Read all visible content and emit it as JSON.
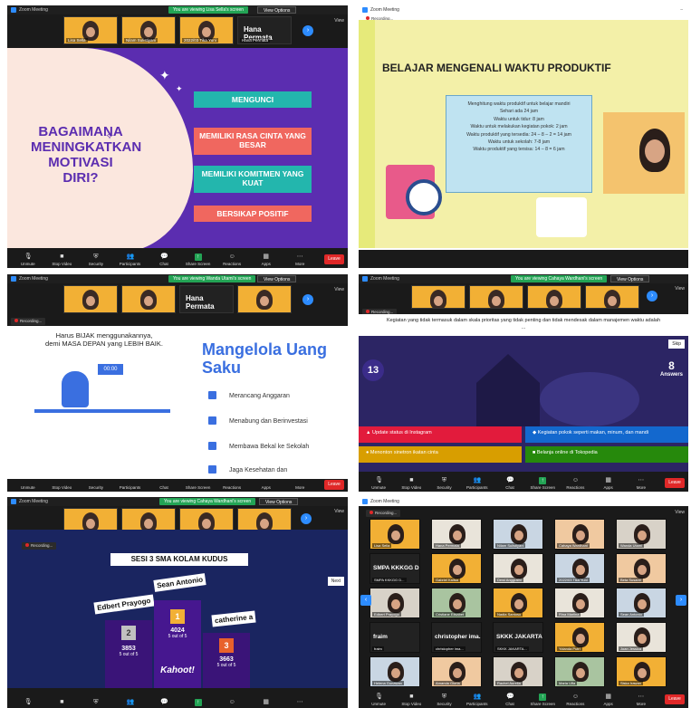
{
  "common": {
    "window_title": "Zoom Meeting",
    "view_label": "View",
    "view_options": "View Options",
    "recording": "Recording...",
    "leave": "Leave",
    "toolbar": [
      "Unmute",
      "Stop Video",
      "Security",
      "Participants",
      "Chat",
      "Share Screen",
      "Reactions",
      "Apps",
      "More"
    ]
  },
  "tile1": {
    "viewing": "You are viewing Lisa Sella's screen",
    "presenter": "Hana Permata",
    "thumbs": [
      "Lisa Sella",
      "Nilam Sulistiyani",
      "2022/03 Tika Yuni"
    ],
    "presenter_tag": "Hana Permata",
    "question": "BAGAIMANA MENINGKATKAN MOTIVASI DIRI?",
    "pills": [
      {
        "text": "MENGUNCI",
        "color": "#23b6ad"
      },
      {
        "text": "MEMILIKI RASA CINTA YANG BESAR",
        "color": "#f0675f"
      },
      {
        "text": "MEMILIKI KOMITMEN YANG KUAT",
        "color": "#23b6ad"
      },
      {
        "text": "BERSIKAP POSITIF",
        "color": "#f0675f"
      }
    ],
    "participant_count": "101"
  },
  "tile2": {
    "title": "BELAJAR MENGENALI WAKTU PRODUKTIF",
    "lines": [
      "Menghitung waktu produktif untuk belajar mandiri",
      "Sehari ada 24 jam",
      "Waktu untuk tidur: 8 jam",
      "Waktu untuk melakukan kegiatan pokok: 2 jam",
      "Waktu produktif yang tersedia: 24 – 8 – 2 = 14 jam",
      "Waktu untuk sekolah: 7-8 jam",
      "Waktu produktif yang tersisa: 14 – 8 = 6 jam"
    ]
  },
  "tile3": {
    "viewing": "You are viewing Wanda Utami's screen",
    "presenter": "Hana Permata",
    "tagline1": "Harus BIJAK menggunakannya,",
    "tagline2": "demi MASA DEPAN yang LEBIH BAIK.",
    "heading": "Mangelola Uang Saku",
    "items": [
      "Merancang Anggaran",
      "Menabung dan Berinvestasi",
      "Membawa Bekal ke Sekolah",
      "Jaga Kesehatan dan"
    ],
    "clock": "00:00"
  },
  "tile4": {
    "viewing": "You are viewing Cahaya Wardhani's screen",
    "question": "Kegiatan yang tidak termasuk dalam skala prioritas yang tidak penting dan tidak mendesak dalam manajemen waktu adalah ...",
    "timer": "13",
    "answers_count": "8",
    "answers_label": "Answers",
    "skip": "Skip",
    "answers": [
      {
        "text": "Update status di Instagram",
        "color": "#e21b3c"
      },
      {
        "text": "Kegiatan pokok seperti makan, minum, dan mandi",
        "color": "#1368ce"
      },
      {
        "text": "Menonton sinetron ikatan cinta",
        "color": "#d89e00"
      },
      {
        "text": "Belanja online di Tokopedia",
        "color": "#26890c"
      }
    ]
  },
  "tile5": {
    "viewing": "You are viewing Cahaya Wardhani's screen",
    "title": "SESI 3 SMA KOLAM KUDUS",
    "podium": [
      {
        "name": "Sean Antonio",
        "rank": "1",
        "score": "4024",
        "out": "5 out of 5"
      },
      {
        "name": "Edbert Prayogo",
        "rank": "2",
        "score": "3853",
        "out": "5 out of 5"
      },
      {
        "name": "catherine a",
        "rank": "3",
        "score": "3663",
        "out": "5 out of 5"
      }
    ],
    "brand": "Kahoot!",
    "next": "Next"
  },
  "tile6": {
    "rows": [
      [
        "Lisa Sella",
        "Hana Permata",
        "Nilam Sulistiyani",
        "Cahaya Wardhani",
        "Wanda Utami"
      ],
      [
        "SMPA KKKGG D...",
        "Gabriel Kallsa",
        "Dewi Anggraini",
        "2022/03 Tika Yuni",
        "Beta Susanti"
      ],
      [
        "Edbert Prayogo",
        "Cristiane Elisabet",
        "Nadia Santoso",
        "Rina Marlina",
        "Sean Antonio"
      ],
      [
        "fraim",
        "christopher ima...",
        "SKKK JAKARTA...",
        "Yolanda Putri",
        "Joan Jessica"
      ],
      [
        "Helena Gunawan",
        "Amanda Gloria",
        "Rachel Aurelia",
        "Maria Ulfa",
        "Siska Irawan"
      ]
    ]
  }
}
